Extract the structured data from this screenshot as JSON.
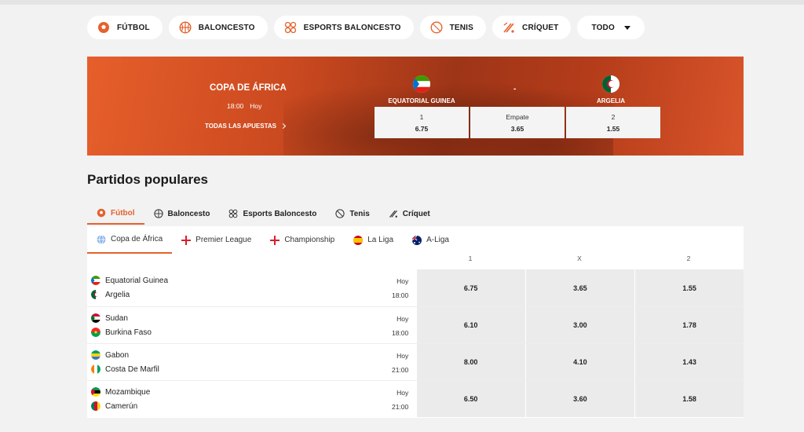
{
  "sport_nav": [
    {
      "label": "FÚTBOL",
      "icon": "soccer-ball-icon"
    },
    {
      "label": "BALONCESTO",
      "icon": "basketball-icon"
    },
    {
      "label": "ESPORTS BALONCESTO",
      "icon": "esports-icon"
    },
    {
      "label": "TENIS",
      "icon": "tennis-ball-icon"
    },
    {
      "label": "CRÍQUET",
      "icon": "cricket-icon"
    },
    {
      "label": "TODO",
      "icon": "chevron-down-icon"
    }
  ],
  "banner": {
    "competition": "COPA DE ÁFRICA",
    "time": "18:00",
    "day": "Hoy",
    "all_bets": "TODAS LAS APUESTAS",
    "home_team": "EQUATORIAL GUINEA",
    "away_team": "ARGELIA",
    "separator": "-",
    "odds": [
      {
        "label": "1",
        "value": "6.75"
      },
      {
        "label": "Empate",
        "value": "3.65"
      },
      {
        "label": "2",
        "value": "1.55"
      }
    ]
  },
  "section_title": "Partidos populares",
  "sport_tabs": [
    {
      "label": "Fútbol",
      "active": true
    },
    {
      "label": "Baloncesto",
      "active": false
    },
    {
      "label": "Esports Baloncesto",
      "active": false
    },
    {
      "label": "Tenis",
      "active": false
    },
    {
      "label": "Críquet",
      "active": false
    }
  ],
  "league_tabs": [
    {
      "label": "Copa de África",
      "active": true
    },
    {
      "label": "Premier League",
      "active": false
    },
    {
      "label": "Championship",
      "active": false
    },
    {
      "label": "La Liga",
      "active": false
    },
    {
      "label": "A-Liga",
      "active": false
    }
  ],
  "columns": [
    "1",
    "X",
    "2"
  ],
  "matches": [
    {
      "home": "Equatorial Guinea",
      "away": "Argelia",
      "day": "Hoy",
      "time": "18:00",
      "odds": [
        "6.75",
        "3.65",
        "1.55"
      ]
    },
    {
      "home": "Sudan",
      "away": "Burkina Faso",
      "day": "Hoy",
      "time": "18:00",
      "odds": [
        "6.10",
        "3.00",
        "1.78"
      ]
    },
    {
      "home": "Gabon",
      "away": "Costa De Marfil",
      "day": "Hoy",
      "time": "21:00",
      "odds": [
        "8.00",
        "4.10",
        "1.43"
      ]
    },
    {
      "home": "Mozambique",
      "away": "Camerún",
      "day": "Hoy",
      "time": "21:00",
      "odds": [
        "6.50",
        "3.60",
        "1.58"
      ]
    }
  ],
  "colors": {
    "accent": "#e4622e",
    "banner": "#c9471f"
  }
}
